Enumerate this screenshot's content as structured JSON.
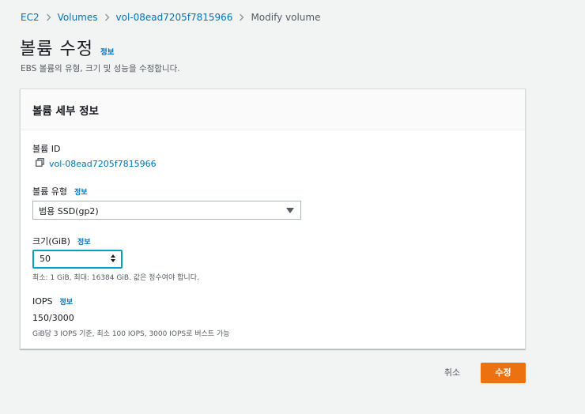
{
  "breadcrumb": {
    "items": [
      "EC2",
      "Volumes",
      "vol-08ead7205f7815966"
    ],
    "current": "Modify volume"
  },
  "header": {
    "title": "볼륨 수정",
    "info_label": "정보",
    "description": "EBS 볼륨의 유형, 크기 및 성능을 수정합니다."
  },
  "panel": {
    "title": "볼륨 세부 정보",
    "volume_id": {
      "label": "볼륨 ID",
      "value": "vol-08ead7205f7815966"
    },
    "volume_type": {
      "label": "볼륨 유형",
      "info_label": "정보",
      "selected": "범용 SSD(gp2)"
    },
    "size": {
      "label": "크기(GiB)",
      "info_label": "정보",
      "value": "50",
      "hint": "최소: 1 GiB, 최대: 16384 GiB. 값은 정수여야 합니다."
    },
    "iops": {
      "label": "IOPS",
      "info_label": "정보",
      "value": "150/3000",
      "hint": "GiB당 3 IOPS 기준, 최소 100 IOPS, 3000 IOPS로 버스트 가능"
    }
  },
  "actions": {
    "cancel_label": "취소",
    "submit_label": "수정"
  },
  "colors": {
    "accent": "#0073bb",
    "primary_button": "#ec7211",
    "focus_ring": "#00a1c9"
  },
  "icons": [
    "chevron-right-icon",
    "copy-icon",
    "caret-down-icon",
    "stepper-icon"
  ]
}
